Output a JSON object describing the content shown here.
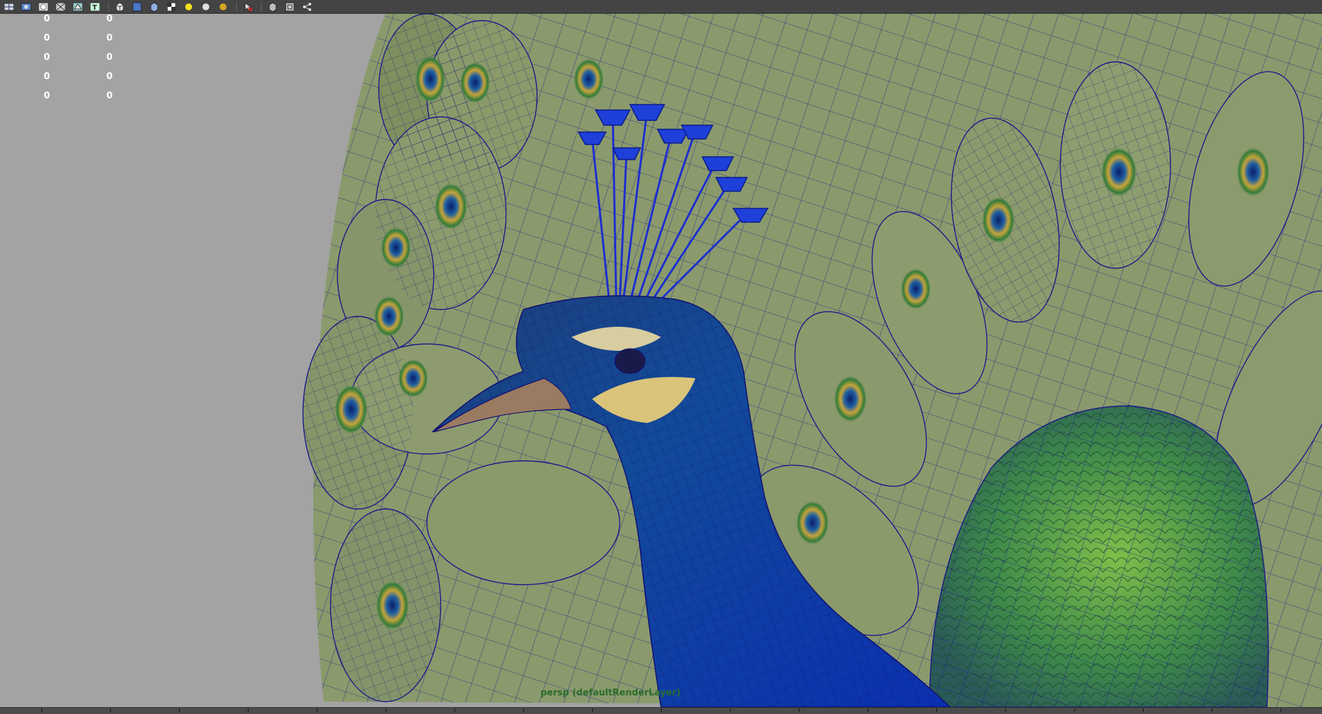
{
  "toolbar": {
    "icons": [
      "grid-icon",
      "camera-icon",
      "sphere-icon",
      "wireframe-icon",
      "textured-icon",
      "texture-t-icon",
      "cube-icon",
      "cube-shaded-icon",
      "cube-lit-icon",
      "checker-icon",
      "light-yellow-icon",
      "light-white-icon",
      "light-gold-icon",
      "select-cursor-icon",
      "cube-outline-icon",
      "film-gate-icon",
      "share-icon"
    ]
  },
  "hud": {
    "left": [
      "0",
      "0",
      "0",
      "0",
      "0"
    ],
    "right": [
      "0",
      "0",
      "0",
      "0",
      "0"
    ]
  },
  "viewport": {
    "camera_label": "persp (defaultRenderLayer)"
  },
  "colors": {
    "toolbar_bg": "#444444",
    "viewport_bg": "#a3a3a3",
    "hud_text": "#ffffff",
    "camera_label": "#2a6b2a",
    "wireframe": "#1a1a8a"
  }
}
